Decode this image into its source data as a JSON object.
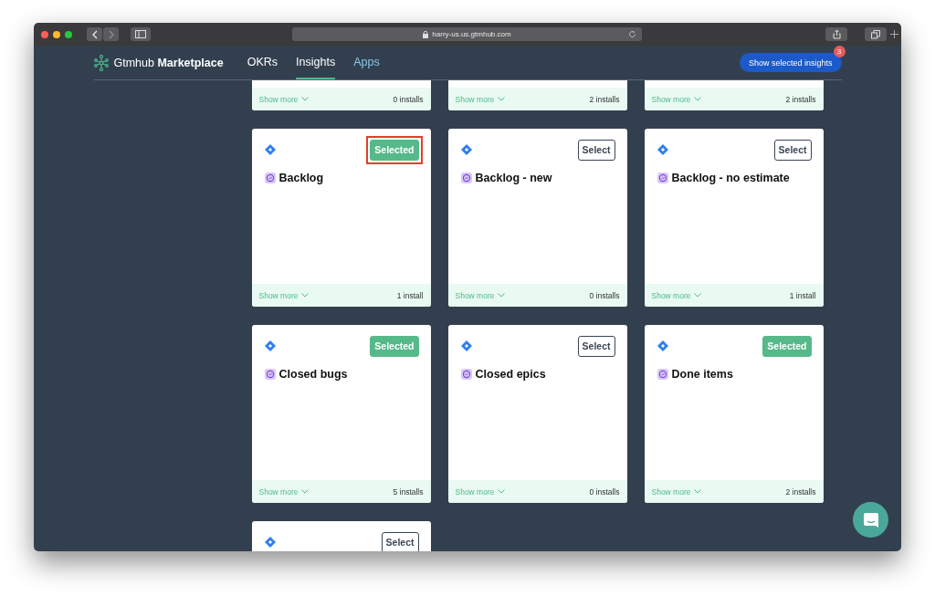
{
  "browser": {
    "address": "harry-us.us.gtmhub.com"
  },
  "nav": {
    "brand": {
      "name": "Gtmhub",
      "product": "Marketplace"
    },
    "links": [
      {
        "label": "OKRs",
        "selected": false,
        "kind": "plain"
      },
      {
        "label": "Insights",
        "selected": true,
        "kind": "plain"
      },
      {
        "label": "Apps",
        "selected": false,
        "kind": "accent"
      }
    ],
    "action": {
      "label": "Show selected insights",
      "badge": "3"
    }
  },
  "cards": [
    {
      "show_more": "Show more",
      "installs": "0 installs"
    },
    {
      "show_more": "Show more",
      "installs": "2 installs"
    },
    {
      "show_more": "Show more",
      "installs": "2 installs"
    },
    {
      "title": "Backlog",
      "button": "Selected",
      "selected": true,
      "highlighted": true,
      "show_more": "Show more",
      "installs": "1 install"
    },
    {
      "title": "Backlog - new",
      "button": "Select",
      "selected": false,
      "highlighted": false,
      "show_more": "Show more",
      "installs": "0 installs"
    },
    {
      "title": "Backlog - no estimate",
      "button": "Select",
      "selected": false,
      "highlighted": false,
      "show_more": "Show more",
      "installs": "1 install"
    },
    {
      "title": "Closed bugs",
      "button": "Selected",
      "selected": true,
      "highlighted": false,
      "show_more": "Show more",
      "installs": "5 installs"
    },
    {
      "title": "Closed epics",
      "button": "Select",
      "selected": false,
      "highlighted": false,
      "show_more": "Show more",
      "installs": "0 installs"
    },
    {
      "title": "Done items",
      "button": "Selected",
      "selected": true,
      "highlighted": false,
      "show_more": "Show more",
      "installs": "2 installs"
    },
    {
      "button": "Select",
      "selected": false,
      "highlighted": false
    }
  ]
}
